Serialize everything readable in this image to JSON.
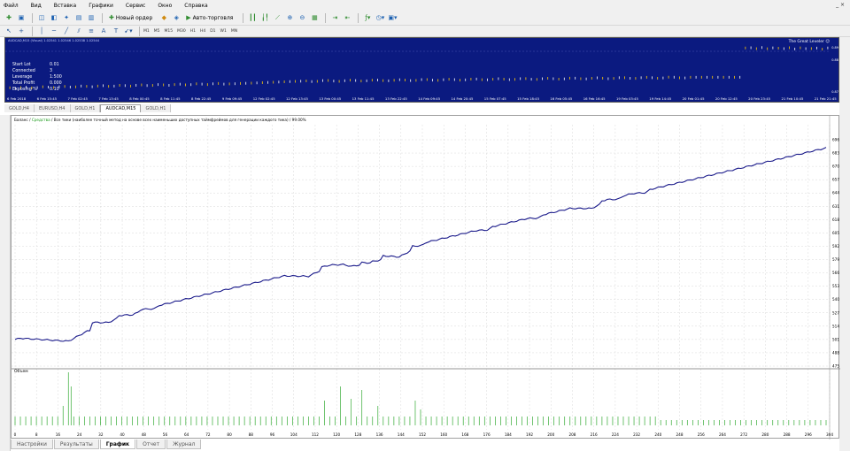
{
  "menu": [
    "Файл",
    "Вид",
    "Вставка",
    "Графики",
    "Сервис",
    "Окно",
    "Справка"
  ],
  "window_controls": "_ ×",
  "toolbar": {
    "new_order": "Новый ордер",
    "auto_trading": "Авто-торговля",
    "timeframes": [
      "M1",
      "M5",
      "M15",
      "M30",
      "H1",
      "H4",
      "D1",
      "W1",
      "MN"
    ]
  },
  "price_chart": {
    "header": "AUDCAD,M15 (Visual) 1.02541 1.02546 1.02538 1.02544",
    "title": "The Great Leveler ☺",
    "stats": [
      {
        "key": "Start Lot",
        "value": "0.01"
      },
      {
        "key": "Connected",
        "value": "3"
      },
      {
        "key": "Leverage",
        "value": "1:500"
      },
      {
        "key": "Total Profit",
        "value": "0.000"
      },
      {
        "key": "Exposing %",
        "value": "0.10"
      }
    ],
    "x_labels": [
      "6 Feb 2018",
      "6 Feb 15:45",
      "7 Feb 02:45",
      "7 Feb 13:45",
      "8 Feb 00:45",
      "8 Feb 11:45",
      "8 Feb 22:45",
      "9 Feb 09:45",
      "12 Feb 02:45",
      "12 Feb 13:45",
      "13 Feb 00:45",
      "13 Feb 11:45",
      "13 Feb 22:45",
      "14 Feb 09:45",
      "14 Feb 20:45",
      "15 Feb 07:45",
      "15 Feb 18:45",
      "16 Feb 05:45",
      "16 Feb 16:45",
      "19 Feb 03:45",
      "19 Feb 14:45",
      "20 Feb 01:45",
      "20 Feb 12:45",
      "20 Feb 23:45",
      "21 Feb 10:45",
      "21 Feb 21:45"
    ],
    "y_labels": [
      "0.89",
      "0.88",
      "0.87"
    ]
  },
  "chart_tabs": [
    "GOLD,H4",
    "EURUSD,H4",
    "GOLD,H1",
    "AUDCAD,M15",
    "GOLD,H1"
  ],
  "tester": {
    "legend_balance": "Баланс",
    "legend_equity": "Средства",
    "legend_rest": "Все тики (наиболее точный метод на основе всех наименьших доступных таймфреймов для генерации каждого тика) / 99.00%",
    "volume_label": "Объем",
    "y_labels": [
      "696",
      "683",
      "670",
      "657",
      "644",
      "631",
      "618",
      "605",
      "592",
      "579",
      "566",
      "553",
      "540",
      "527",
      "514",
      "501",
      "488",
      "475"
    ],
    "x_labels": [
      "0",
      "8",
      "16",
      "24",
      "32",
      "40",
      "48",
      "56",
      "64",
      "72",
      "80",
      "88",
      "96",
      "104",
      "112",
      "120",
      "128",
      "136",
      "144",
      "152",
      "160",
      "168",
      "176",
      "184",
      "192",
      "200",
      "208",
      "216",
      "224",
      "232",
      "240",
      "248",
      "256",
      "264",
      "272",
      "280",
      "288",
      "296",
      "304"
    ]
  },
  "colors": {
    "price_bg": "#0b1a80",
    "balance_line": "#1a1a8a",
    "volume_bar": "#33aa33"
  },
  "bottom_tabs": [
    "Настройки",
    "Результаты",
    "График",
    "Отчет",
    "Журнал"
  ],
  "active_bottom_tab": "График"
}
